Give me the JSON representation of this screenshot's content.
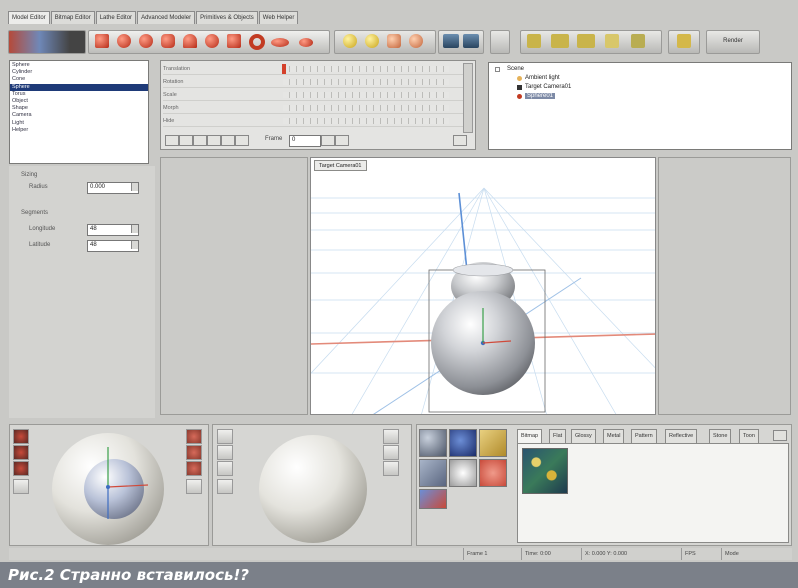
{
  "tabs": [
    {
      "label": "Model Editor"
    },
    {
      "label": "Bitmap Editor"
    },
    {
      "label": "Lathe Editor"
    },
    {
      "label": "Advanced Modeler"
    },
    {
      "label": "Primitives & Objects"
    },
    {
      "label": "Web Helper"
    }
  ],
  "toolbar": {
    "render_button_label": "Render"
  },
  "object_types": [
    {
      "label": "Sphere"
    },
    {
      "label": "Cylinder"
    },
    {
      "label": "Cone"
    },
    {
      "label": "Sphere"
    },
    {
      "label": "Torus"
    },
    {
      "label": "Object"
    },
    {
      "label": "Shape"
    },
    {
      "label": "Camera"
    },
    {
      "label": "Light"
    },
    {
      "label": "Helper"
    }
  ],
  "params": {
    "sizing_label": "Sizing",
    "radius_label": "Radius",
    "radius_value": "0.000",
    "segments_label": "Segments",
    "longitude_label": "Longitude",
    "longitude_value": "48",
    "latitude_label": "Latitude",
    "latitude_value": "48"
  },
  "timeline": {
    "frame_label": "Frame",
    "frame_value": "0",
    "rows": [
      {
        "label": "Translation"
      },
      {
        "label": "Rotation"
      },
      {
        "label": "Scale"
      },
      {
        "label": "Morph"
      },
      {
        "label": "Hide"
      }
    ]
  },
  "scene_tree": {
    "root": "Scene",
    "items": [
      {
        "label": "Ambient light"
      },
      {
        "label": "Target Camera01"
      },
      {
        "label": "Sphere01"
      }
    ]
  },
  "viewport": {
    "title": "Target Camera01"
  },
  "materials": {
    "tabs": [
      {
        "label": "Bitmap"
      },
      {
        "label": "Flat"
      },
      {
        "label": "Glossy"
      },
      {
        "label": "Metal"
      },
      {
        "label": "Pattern"
      },
      {
        "label": "Reflective"
      },
      {
        "label": "Stone"
      },
      {
        "label": "Toon"
      }
    ]
  },
  "status": {
    "frame": "Frame 1",
    "time": "Time: 0:00",
    "coords": "X: 0.000  Y: 0.000",
    "fps": "FPS",
    "mode": "Mode"
  },
  "caption": "Рис.2 Странно вставилось!?",
  "colors": {
    "caption_bg": "#7b8089",
    "selection": "#1e3a78",
    "ball_red": "#c23b22"
  }
}
